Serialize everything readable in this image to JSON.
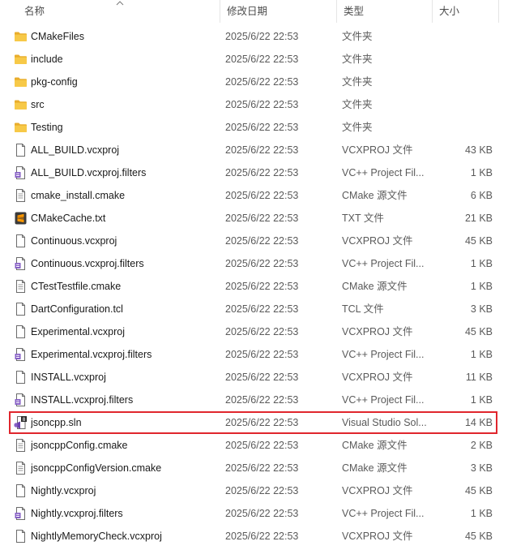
{
  "columns": {
    "name": "名称",
    "date": "修改日期",
    "type": "类型",
    "size": "大小"
  },
  "files": [
    {
      "name": "CMakeFiles",
      "date": "2025/6/22 22:53",
      "type": "文件夹",
      "size": "",
      "icon": "folder"
    },
    {
      "name": "include",
      "date": "2025/6/22 22:53",
      "type": "文件夹",
      "size": "",
      "icon": "folder"
    },
    {
      "name": "pkg-config",
      "date": "2025/6/22 22:53",
      "type": "文件夹",
      "size": "",
      "icon": "folder"
    },
    {
      "name": "src",
      "date": "2025/6/22 22:53",
      "type": "文件夹",
      "size": "",
      "icon": "folder"
    },
    {
      "name": "Testing",
      "date": "2025/6/22 22:53",
      "type": "文件夹",
      "size": "",
      "icon": "folder"
    },
    {
      "name": "ALL_BUILD.vcxproj",
      "date": "2025/6/22 22:53",
      "type": "VCXPROJ 文件",
      "size": "43 KB",
      "icon": "file"
    },
    {
      "name": "ALL_BUILD.vcxproj.filters",
      "date": "2025/6/22 22:53",
      "type": "VC++ Project Fil...",
      "size": "1 KB",
      "icon": "filters"
    },
    {
      "name": "cmake_install.cmake",
      "date": "2025/6/22 22:53",
      "type": "CMake 源文件",
      "size": "6 KB",
      "icon": "text"
    },
    {
      "name": "CMakeCache.txt",
      "date": "2025/6/22 22:53",
      "type": "TXT 文件",
      "size": "21 KB",
      "icon": "sublime"
    },
    {
      "name": "Continuous.vcxproj",
      "date": "2025/6/22 22:53",
      "type": "VCXPROJ 文件",
      "size": "45 KB",
      "icon": "file"
    },
    {
      "name": "Continuous.vcxproj.filters",
      "date": "2025/6/22 22:53",
      "type": "VC++ Project Fil...",
      "size": "1 KB",
      "icon": "filters"
    },
    {
      "name": "CTestTestfile.cmake",
      "date": "2025/6/22 22:53",
      "type": "CMake 源文件",
      "size": "1 KB",
      "icon": "text"
    },
    {
      "name": "DartConfiguration.tcl",
      "date": "2025/6/22 22:53",
      "type": "TCL 文件",
      "size": "3 KB",
      "icon": "file"
    },
    {
      "name": "Experimental.vcxproj",
      "date": "2025/6/22 22:53",
      "type": "VCXPROJ 文件",
      "size": "45 KB",
      "icon": "file"
    },
    {
      "name": "Experimental.vcxproj.filters",
      "date": "2025/6/22 22:53",
      "type": "VC++ Project Fil...",
      "size": "1 KB",
      "icon": "filters"
    },
    {
      "name": "INSTALL.vcxproj",
      "date": "2025/6/22 22:53",
      "type": "VCXPROJ 文件",
      "size": "11 KB",
      "icon": "file"
    },
    {
      "name": "INSTALL.vcxproj.filters",
      "date": "2025/6/22 22:53",
      "type": "VC++ Project Fil...",
      "size": "1 KB",
      "icon": "filters"
    },
    {
      "name": "jsoncpp.sln",
      "date": "2025/6/22 22:53",
      "type": "Visual Studio Sol...",
      "size": "14 KB",
      "icon": "sln",
      "highlighted": true
    },
    {
      "name": "jsoncppConfig.cmake",
      "date": "2025/6/22 22:53",
      "type": "CMake 源文件",
      "size": "2 KB",
      "icon": "text"
    },
    {
      "name": "jsoncppConfigVersion.cmake",
      "date": "2025/6/22 22:53",
      "type": "CMake 源文件",
      "size": "3 KB",
      "icon": "text"
    },
    {
      "name": "Nightly.vcxproj",
      "date": "2025/6/22 22:53",
      "type": "VCXPROJ 文件",
      "size": "45 KB",
      "icon": "file"
    },
    {
      "name": "Nightly.vcxproj.filters",
      "date": "2025/6/22 22:53",
      "type": "VC++ Project Fil...",
      "size": "1 KB",
      "icon": "filters"
    },
    {
      "name": "NightlyMemoryCheck.vcxproj",
      "date": "2025/6/22 22:53",
      "type": "VCXPROJ 文件",
      "size": "45 KB",
      "icon": "file"
    }
  ],
  "colors": {
    "folder": "#f7c948",
    "highlight_border": "#e0262d",
    "sublime": "#ff9800",
    "vs_purple": "#865fc5"
  }
}
